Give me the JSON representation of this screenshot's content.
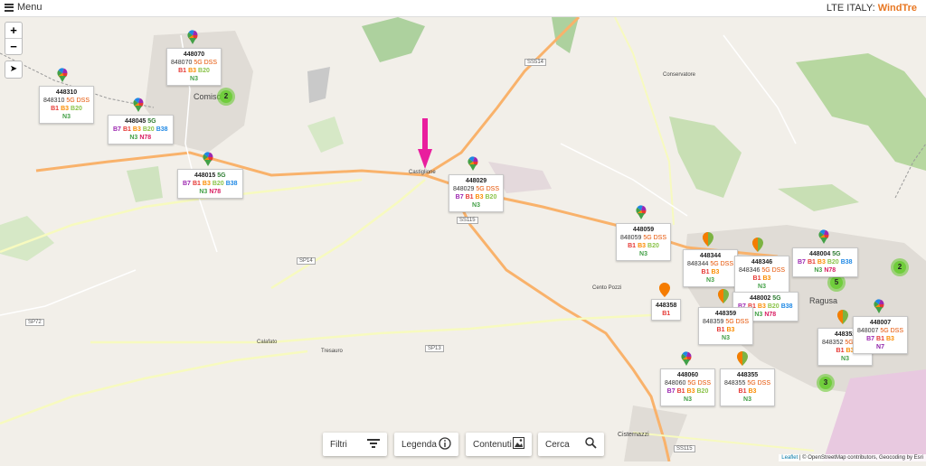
{
  "header": {
    "menu_label": "Menu",
    "brand_prefix": "LTE ITALY:",
    "brand_operator": "WindTre"
  },
  "controls": {
    "zoom_in": "+",
    "zoom_out": "−"
  },
  "towns": {
    "comiso": "Comiso",
    "castiglione": "Castiglione",
    "ragusa": "Ragusa",
    "calafato": "Calafato",
    "tresauro": "Tresauro",
    "conservatore": "Conservatore",
    "cisternazzi": "Cisternazzi",
    "centro_pozzi": "Cento Pozzi"
  },
  "roads": {
    "ss514": "SS514",
    "ss115a": "SS115",
    "ss115b": "SS115",
    "sp14": "SP14",
    "sp13": "SP13",
    "sp72": "SP72"
  },
  "clusters": {
    "c1": "2",
    "c2": "2",
    "c3": "5",
    "c4": "3"
  },
  "sites": [
    {
      "id": "448070",
      "tech": "848070",
      "five": "",
      "dss": "5G DSS",
      "bands": [
        "B1",
        "B3",
        "B20"
      ],
      "nr": [
        "N3"
      ]
    },
    {
      "id": "448310",
      "tech": "848310",
      "five": "",
      "dss": "5G DSS",
      "bands": [
        "B1",
        "B3",
        "B20"
      ],
      "nr": [
        "N3"
      ]
    },
    {
      "id": "448045",
      "tech": "",
      "five": "5G",
      "dss": "",
      "bands": [
        "B7",
        "B1",
        "B3",
        "B20",
        "B38"
      ],
      "nr": [
        "N3",
        "N78"
      ]
    },
    {
      "id": "448015",
      "tech": "",
      "five": "5G",
      "dss": "",
      "bands": [
        "B7",
        "B1",
        "B3",
        "B20",
        "B38"
      ],
      "nr": [
        "N3",
        "N78"
      ]
    },
    {
      "id": "448029",
      "tech": "848029",
      "five": "",
      "dss": "5G DSS",
      "bands": [
        "B7",
        "B1",
        "B3",
        "B20"
      ],
      "nr": [
        "N3"
      ]
    },
    {
      "id": "448059",
      "tech": "848059",
      "five": "",
      "dss": "5G DSS",
      "bands": [
        "B1",
        "B3",
        "B20"
      ],
      "nr": [
        "N3"
      ]
    },
    {
      "id": "448344",
      "tech": "848344",
      "five": "",
      "dss": "5G DSS",
      "bands": [
        "B1",
        "B3"
      ],
      "nr": [
        "N3"
      ]
    },
    {
      "id": "448346",
      "tech": "848346",
      "five": "",
      "dss": "5G DSS",
      "bands": [
        "B1",
        "B3"
      ],
      "nr": [
        "N3"
      ]
    },
    {
      "id": "448004",
      "tech": "",
      "five": "5G",
      "dss": "",
      "bands": [
        "B7",
        "B1",
        "B3",
        "B20",
        "B38"
      ],
      "nr": [
        "N3",
        "N78"
      ]
    },
    {
      "id": "448358",
      "tech": "",
      "five": "",
      "dss": "",
      "bands": [
        "B1"
      ],
      "nr": []
    },
    {
      "id": "448002",
      "tech": "",
      "five": "5G",
      "dss": "",
      "bands": [
        "B7",
        "B1",
        "B3",
        "B20",
        "B38"
      ],
      "nr": [
        "N3",
        "N78"
      ]
    },
    {
      "id": "448359",
      "tech": "848359",
      "five": "",
      "dss": "5G DSS",
      "bands": [
        "B1",
        "B3"
      ],
      "nr": [
        "N3"
      ]
    },
    {
      "id": "448352",
      "tech": "848352",
      "five": "",
      "dss": "5G DSS",
      "bands": [
        "B1",
        "B3"
      ],
      "nr": [
        "N3"
      ]
    },
    {
      "id": "448007",
      "tech": "848007",
      "five": "",
      "dss": "5G DSS",
      "bands": [
        "B7",
        "B1",
        "B3"
      ],
      "nr": [
        "N7"
      ]
    },
    {
      "id": "448060",
      "tech": "848060",
      "five": "",
      "dss": "5G DSS",
      "bands": [
        "B7",
        "B1",
        "B3",
        "B20"
      ],
      "nr": [
        "N3"
      ]
    },
    {
      "id": "448355",
      "tech": "848355",
      "five": "",
      "dss": "5G DSS",
      "bands": [
        "B1",
        "B3"
      ],
      "nr": [
        "N3"
      ]
    }
  ],
  "toolbar": {
    "filtri": "Filtri",
    "legenda": "Legenda",
    "contenuti": "Contenuti",
    "cerca": "Cerca"
  },
  "attribution": {
    "leaflet": "Leaflet",
    "rest": "| © OpenStreetMap contributors, Geocoding by Esri"
  }
}
